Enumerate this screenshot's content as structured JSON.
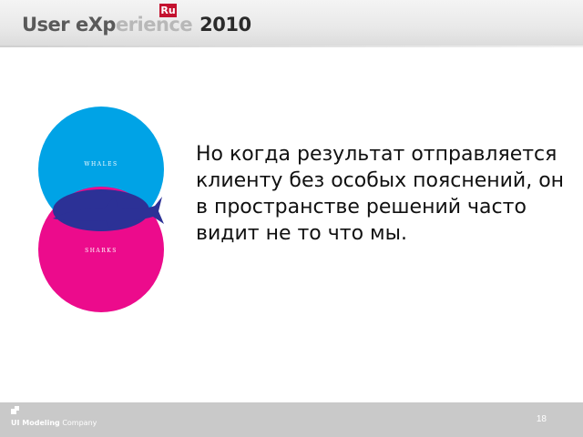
{
  "header": {
    "logo_part1": "User eXp",
    "logo_part2": "erience",
    "logo_badge": "Ru",
    "logo_year": "2010",
    "colors": {
      "badge": "#c4122f",
      "text": "#5a5a5a"
    }
  },
  "illustration": {
    "top_label": "WHALES",
    "bottom_label": "SHARKS",
    "colors": {
      "top": "#00a3e6",
      "bottom": "#ec0b8c",
      "overlap": "#2c3196"
    },
    "icon": "shark-icon"
  },
  "slide": {
    "text": "Но когда результат отправляется клиенту без особых пояснений, он в пространстве решений часто видит не то что мы."
  },
  "footer": {
    "company_bold": "UI Modeling",
    "company_rest": "Company",
    "page_number": "18"
  }
}
